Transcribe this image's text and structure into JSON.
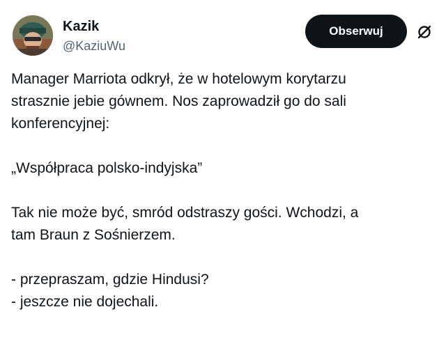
{
  "author": {
    "display_name": "Kazik",
    "handle": "@KaziuWu"
  },
  "follow_button": {
    "label": "Obserwuj"
  },
  "icons": {
    "more": "more-options-icon",
    "avatar": "avatar"
  },
  "tweet": {
    "paragraphs": [
      {
        "lines": [
          "Manager Marriota odkrył, że w hotelowym korytarzu",
          "strasznie jebie gównem. Nos zaprowadził go do sali",
          "konferencyjnej:"
        ]
      },
      {
        "lines": [
          "„Współpraca polsko-indyjska”"
        ]
      },
      {
        "lines": [
          "Tak nie może być, smród odstraszy gości. Wchodzi, a",
          "tam Braun z Sośnierzem."
        ]
      },
      {
        "lines": [
          "- przepraszam, gdzie Hindusi?",
          "- jeszcze nie dojechali."
        ]
      }
    ]
  },
  "colors": {
    "text": "#0f1419",
    "secondary_text": "#536471",
    "button_bg": "#0f1419",
    "button_text": "#ffffff",
    "background": "#ffffff"
  }
}
